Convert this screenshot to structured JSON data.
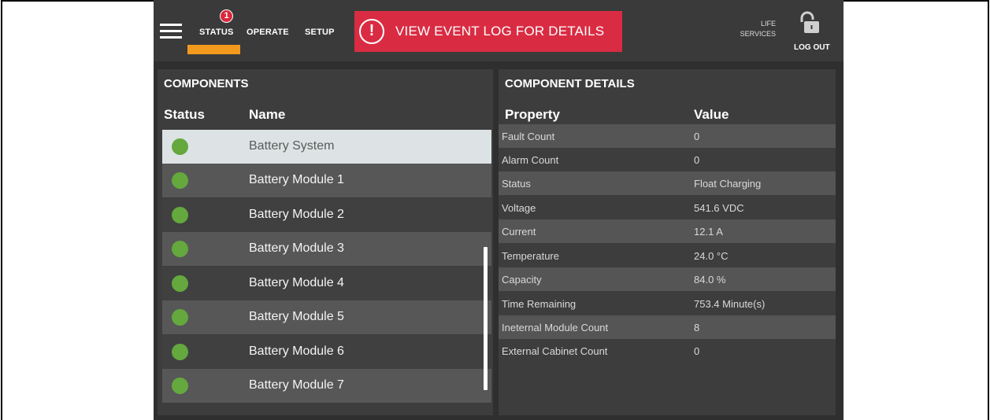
{
  "header": {
    "nav": [
      {
        "label": "STATUS",
        "badge": "1",
        "active": true
      },
      {
        "label": "OPERATE"
      },
      {
        "label": "SETUP"
      }
    ],
    "event_banner": "VIEW EVENT LOG FOR DETAILS",
    "life_services": [
      "LIFE",
      "SERVICES"
    ],
    "logout": "LOG OUT",
    "colors": {
      "accent": "#f39a1e",
      "alert": "#d92c43",
      "ok": "#64a83e"
    }
  },
  "components": {
    "title": "COMPONENTS",
    "headers": {
      "status": "Status",
      "name": "Name"
    },
    "items": [
      {
        "name": "Battery System",
        "status": "ok",
        "selected": true
      },
      {
        "name": "Battery Module 1",
        "status": "ok"
      },
      {
        "name": "Battery Module 2",
        "status": "ok"
      },
      {
        "name": "Battery Module 3",
        "status": "ok"
      },
      {
        "name": "Battery Module 4",
        "status": "ok"
      },
      {
        "name": "Battery Module 5",
        "status": "ok"
      },
      {
        "name": "Battery Module 6",
        "status": "ok"
      },
      {
        "name": "Battery Module 7",
        "status": "ok"
      }
    ]
  },
  "details": {
    "title": "COMPONENT DETAILS",
    "headers": {
      "property": "Property",
      "value": "Value"
    },
    "rows": [
      {
        "property": "Fault Count",
        "value": "0"
      },
      {
        "property": "Alarm Count",
        "value": "0"
      },
      {
        "property": "Status",
        "value": "Float Charging"
      },
      {
        "property": "Voltage",
        "value": "541.6 VDC"
      },
      {
        "property": "Current",
        "value": "12.1 A"
      },
      {
        "property": "Temperature",
        "value": "24.0 °C"
      },
      {
        "property": "Capacity",
        "value": "84.0 %"
      },
      {
        "property": "Time Remaining",
        "value": "753.4 Minute(s)"
      },
      {
        "property": "Ineternal Module Count",
        "value": "8"
      },
      {
        "property": "External Cabinet Count",
        "value": "0"
      }
    ]
  }
}
